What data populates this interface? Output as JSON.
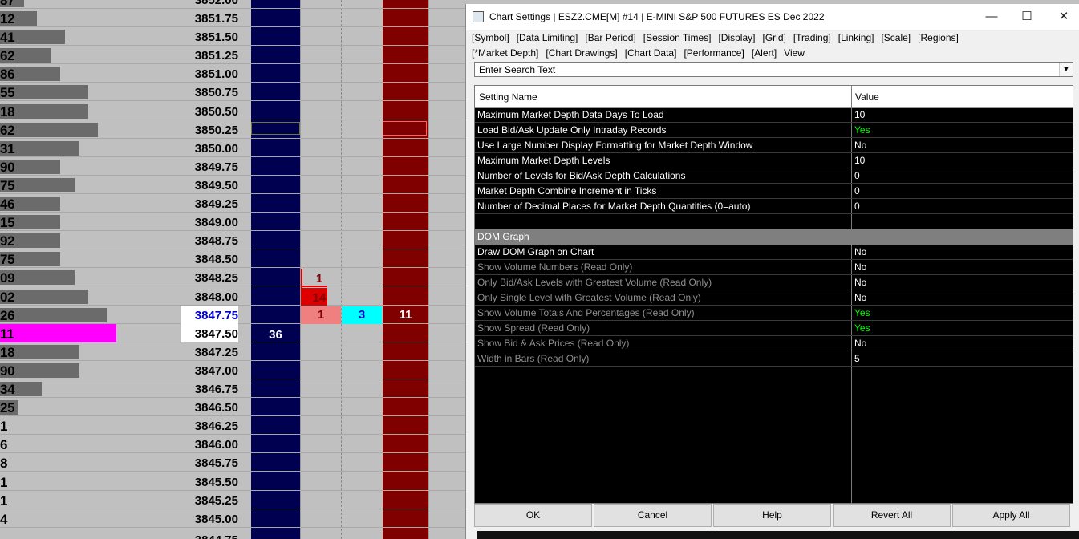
{
  "dom": {
    "top_partial": {
      "vol": "87",
      "price": "3852.00"
    },
    "rows": [
      {
        "vol": "12",
        "price": "3851.75",
        "bar": 0.08
      },
      {
        "vol": "41",
        "price": "3851.50",
        "bar": 0.14
      },
      {
        "vol": "62",
        "price": "3851.25",
        "bar": 0.11
      },
      {
        "vol": "86",
        "price": "3851.00",
        "bar": 0.13
      },
      {
        "vol": "55",
        "price": "3850.75",
        "bar": 0.19
      },
      {
        "vol": "18",
        "price": "3850.50",
        "bar": 0.19
      },
      {
        "vol": "62",
        "price": "3850.25",
        "bar": 0.21
      },
      {
        "vol": "31",
        "price": "3850.00",
        "bar": 0.17
      },
      {
        "vol": "90",
        "price": "3849.75",
        "bar": 0.13
      },
      {
        "vol": "75",
        "price": "3849.50",
        "bar": 0.16
      },
      {
        "vol": "46",
        "price": "3849.25",
        "bar": 0.13
      },
      {
        "vol": "15",
        "price": "3849.00",
        "bar": 0.13
      },
      {
        "vol": "92",
        "price": "3848.75",
        "bar": 0.13
      },
      {
        "vol": "75",
        "price": "3848.50",
        "bar": 0.13
      },
      {
        "vol": "09",
        "price": "3848.25",
        "bar": 0.16
      },
      {
        "vol": "02",
        "price": "3848.00",
        "bar": 0.19
      },
      {
        "vol": "26",
        "price": "3847.75",
        "bar": 0.23
      },
      {
        "vol": "11",
        "price": "3847.50",
        "bar": 0.25
      },
      {
        "vol": "18",
        "price": "3847.25",
        "bar": 0.17
      },
      {
        "vol": "90",
        "price": "3847.00",
        "bar": 0.17
      },
      {
        "vol": "34",
        "price": "3846.75",
        "bar": 0.09
      },
      {
        "vol": "25",
        "price": "3846.50",
        "bar": 0.04
      },
      {
        "vol": "1",
        "price": "3846.25",
        "bar": 0
      },
      {
        "vol": "6",
        "price": "3846.00",
        "bar": 0
      },
      {
        "vol": "8",
        "price": "3845.75",
        "bar": 0
      },
      {
        "vol": "1",
        "price": "3845.50",
        "bar": 0
      },
      {
        "vol": "1",
        "price": "3845.25",
        "bar": 0
      },
      {
        "vol": "4",
        "price": "3845.00",
        "bar": 0
      }
    ],
    "bottom_partial": {
      "price": "3844.75"
    },
    "cells": {
      "bid_at_3847_50": "36",
      "sell_at_3848_25": "1",
      "sell_at_3848_00": "14",
      "sell_at_3847_75": "1",
      "buy_at_3847_75": "3",
      "ask_at_3847_75": "11"
    },
    "colors": {
      "bid": "#000050",
      "ask": "#800000",
      "bar": "#6b6b6b",
      "highlight_vol": "#ff00ff",
      "cyan": "#00ffff",
      "pink": "#f08080",
      "red": "#dd0000"
    }
  },
  "dialog": {
    "title": "Chart Settings | ESZ2.CME[M]  #14 | E-MINI S&P 500 FUTURES ES Dec 2022",
    "menu_row1": [
      "[Symbol]",
      "[Data Limiting]",
      "[Bar Period]",
      "[Session Times]",
      "[Display]",
      "[Grid]",
      "[Trading]",
      "[Linking]",
      "[Scale]",
      "[Regions]"
    ],
    "menu_row2": [
      "[*Market Depth]",
      "[Chart Drawings]",
      "[Chart Data]",
      "[Performance]",
      "[Alert]",
      "View"
    ],
    "search_placeholder": "Enter Search Text",
    "columns": {
      "name": "Setting Name",
      "value": "Value"
    },
    "settings": [
      {
        "name": "Maximum Market Depth Data Days To Load",
        "value": "10"
      },
      {
        "name": "Load Bid/Ask Update Only Intraday Records",
        "value": "Yes",
        "green": true
      },
      {
        "name": "Use Large Number Display Formatting for Market Depth Window",
        "value": "No"
      },
      {
        "name": "Maximum Market Depth Levels",
        "value": "10"
      },
      {
        "name": "Number of Levels for Bid/Ask Depth Calculations",
        "value": "0"
      },
      {
        "name": "Market Depth Combine Increment in Ticks",
        "value": "0"
      },
      {
        "name": "Number of Decimal Places for Market Depth Quantities (0=auto)",
        "value": "0"
      }
    ],
    "section_title": "DOM Graph",
    "dom_graph": [
      {
        "name": "Draw DOM Graph on Chart",
        "value": "No",
        "readonly": false
      },
      {
        "name": "Show Volume Numbers (Read Only)",
        "value": "No",
        "readonly": true
      },
      {
        "name": "Only Bid/Ask Levels with Greatest Volume (Read Only)",
        "value": "No",
        "readonly": true
      },
      {
        "name": "Only Single Level with Greatest Volume (Read Only)",
        "value": "No",
        "readonly": true
      },
      {
        "name": "Show Volume Totals And Percentages (Read Only)",
        "value": "Yes",
        "readonly": true,
        "green": true
      },
      {
        "name": "Show Spread (Read Only)",
        "value": "Yes",
        "readonly": true,
        "green": true
      },
      {
        "name": "Show Bid & Ask Prices (Read Only)",
        "value": "No",
        "readonly": true
      },
      {
        "name": "Width in Bars (Read Only)",
        "value": "5",
        "readonly": true
      }
    ],
    "buttons": [
      "OK",
      "Cancel",
      "Help",
      "Revert All",
      "Apply All"
    ],
    "colors": {
      "yes": "#00ff00",
      "readonly_text": "#8f8f8f"
    }
  }
}
